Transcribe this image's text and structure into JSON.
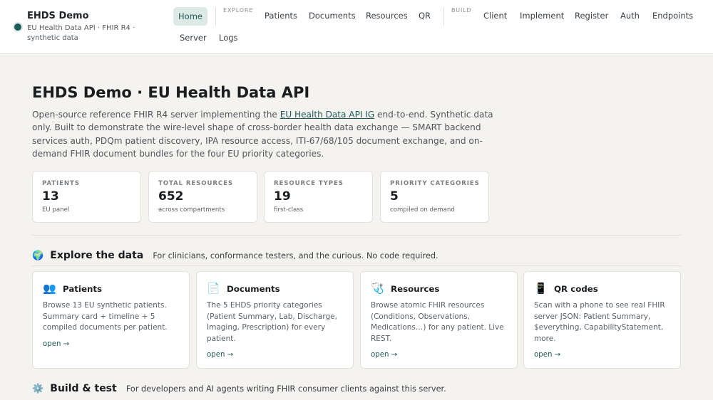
{
  "brand": {
    "title": "EHDS Demo",
    "subtitle": "EU Health Data API · FHIR R4 · synthetic data"
  },
  "nav": {
    "home": "Home",
    "explore_label": "EXPLORE",
    "build_label": "BUILD",
    "explore_items": [
      "Patients",
      "Documents",
      "Resources",
      "QR"
    ],
    "build_items": [
      "Client",
      "Implement",
      "Register",
      "Auth",
      "Endpoints"
    ],
    "second_row": [
      "Server",
      "Logs"
    ]
  },
  "hero": {
    "title": "EHDS Demo · EU Health Data API",
    "desc_before": "Open-source reference FHIR R4 server implementing the ",
    "desc_link": "EU Health Data API IG",
    "desc_after": " end-to-end. Synthetic data only. Built to demonstrate the wire-level shape of cross-border health data exchange — SMART backend services auth, PDQm patient discovery, IPA resource access, ITI-67/68/105 document exchange, and on-demand FHIR document bundles for the four EU priority categories."
  },
  "stats": [
    {
      "label": "PATIENTS",
      "value": "13",
      "sub": "EU panel"
    },
    {
      "label": "TOTAL RESOURCES",
      "value": "652",
      "sub": "across compartments"
    },
    {
      "label": "RESOURCE TYPES",
      "value": "19",
      "sub": "first-class"
    },
    {
      "label": "PRIORITY CATEGORIES",
      "value": "5",
      "sub": "compiled on demand"
    }
  ],
  "explore": {
    "icon": "🌍",
    "title": "Explore the data",
    "subtitle": "For clinicians, conformance testers, and the curious. No code required."
  },
  "cards": [
    {
      "icon": "👥",
      "icon_name": "people-icon",
      "title": "Patients",
      "desc": "Browse 13 EU synthetic patients. Summary card + timeline + 5 compiled documents per patient.",
      "link": "open →"
    },
    {
      "icon": "📄",
      "icon_name": "document-icon",
      "title": "Documents",
      "desc": "The 5 EHDS priority categories (Patient Summary, Lab, Discharge, Imaging, Prescription) for every patient.",
      "link": "open →"
    },
    {
      "icon": "🩺",
      "icon_name": "stethoscope-icon",
      "title": "Resources",
      "desc": "Browse atomic FHIR resources (Conditions, Observations, Medications…) for any patient. Live REST.",
      "link": "open →"
    },
    {
      "icon": "📱",
      "icon_name": "phone-icon",
      "title": "QR codes",
      "desc": "Scan with a phone to see real FHIR server JSON: Patient Summary, $everything, CapabilityStatement, more.",
      "link": "open →"
    }
  ],
  "build": {
    "icon": "⚙️",
    "title": "Build & test",
    "subtitle": "For developers and AI agents writing FHIR consumer clients against this server."
  },
  "colors": {
    "accent": "#1f5b56",
    "background": "#f4f3ef",
    "card": "#ffffff"
  }
}
